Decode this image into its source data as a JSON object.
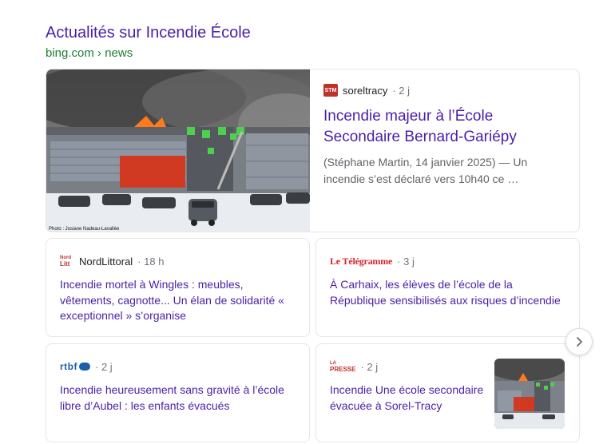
{
  "header": {
    "title": "Actualités sur Incendie École",
    "source": "bing.com › news"
  },
  "hero": {
    "publisher": "soreltracy",
    "publisher_logo": "STM",
    "time": "· 2 j",
    "title": "Incendie majeur à l’École Secondaire Bernard-Gariépy",
    "snippet": "(Stéphane Martin, 14 janvier 2025) — Un incendie s’est déclaré vers 10h40 ce …",
    "photo_credit": "Photo : Josiane Nadeau-Lavallée"
  },
  "cards": [
    {
      "publisher": "NordLittoral",
      "logo_top": "Nord",
      "logo_bottom": "Litt",
      "time": "· 18 h",
      "title": "Incendie mortel à Wingles : meubles, vêtements, cagnotte... Un élan de solidarité « exceptionnel » s’organise"
    },
    {
      "publisher_logo": "Le Télégramme",
      "time": "· 3 j",
      "title": "À Carhaix, les élèves de l’école de la République sensibilisés aux risques d’incendie"
    },
    {
      "publisher_logo": "rtbf",
      "time": "· 2 j",
      "title": "Incendie heureusement sans gravité à l’école libre d’Aubel : les enfants évacués"
    },
    {
      "logo_top": "LA",
      "logo_bottom": "PRESSE",
      "time": "· 2 j",
      "title": "Incendie Une école secondaire évacuée à Sorel-Tracy"
    }
  ],
  "icons": {
    "next": "chevron-right-icon"
  },
  "colors": {
    "title": "#4a1fa8",
    "source": "#1a7f37"
  }
}
